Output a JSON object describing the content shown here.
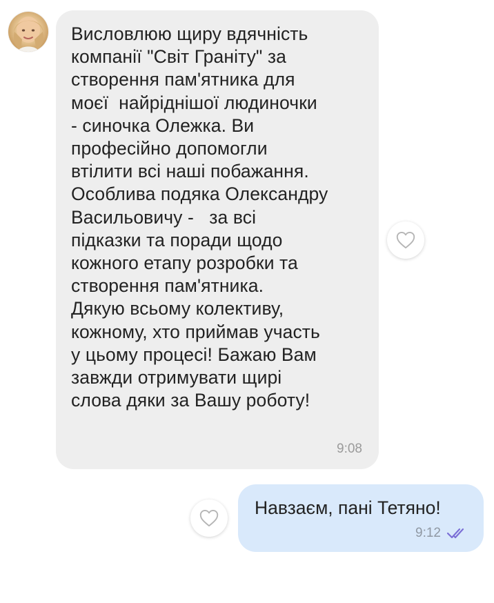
{
  "chat": {
    "incoming": {
      "avatar_icon": "user-avatar-photo",
      "text": "Висловлюю щиру вдячність\nкомпанії \"Світ Граніту\" за\nстворення пам'ятника для\nмоєї  найріднішої людиночки\n- синочка Олежка. Ви\nпрофесійно допомогли\nвтілити всі наші побажання.\nОсоблива подяка Олександру\nВасильовичу -   за всі\nпідказки та поради щодо\nкожного етапу розробки та\nстворення пам'ятника.\nДякую всьому колективу,\nкожному, хто приймав участь\nу цьому процесі! Бажаю Вам\nзавжди отримувати щирі\nслова дяки за Вашу роботу!",
      "time": "9:08",
      "like_icon": "heart-outline-icon"
    },
    "outgoing": {
      "text": "Навзаєм, пані Тетяно!",
      "time": "9:12",
      "status_icon": "double-check-icon",
      "like_icon": "heart-outline-icon"
    }
  },
  "colors": {
    "incoming_bubble": "#eeeeee",
    "outgoing_bubble": "#d9e9fb",
    "read_check": "#7b6fd6",
    "time_text": "#9a9a9a"
  }
}
